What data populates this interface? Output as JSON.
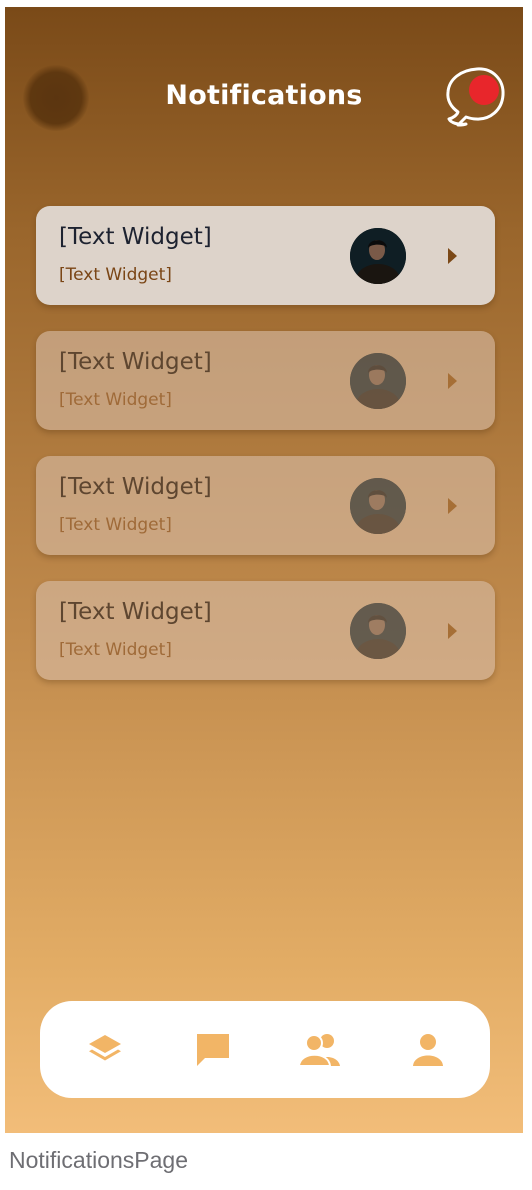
{
  "header": {
    "title": "Notifications"
  },
  "notifications": [
    {
      "title": "[Text Widget]",
      "subtitle": "[Text Widget]"
    },
    {
      "title": "[Text Widget]",
      "subtitle": "[Text Widget]"
    },
    {
      "title": "[Text Widget]",
      "subtitle": "[Text Widget]"
    },
    {
      "title": "[Text Widget]",
      "subtitle": "[Text Widget]"
    }
  ],
  "bottom_nav": {
    "items": [
      {
        "icon": "layers-icon"
      },
      {
        "icon": "chat-icon"
      },
      {
        "icon": "group-icon"
      },
      {
        "icon": "person-icon"
      }
    ]
  },
  "colors": {
    "accent": "#f2b566",
    "alert_dot": "#e8262b",
    "gradient_top": "#7a4a18",
    "gradient_bottom": "#f2bd79"
  },
  "caption": "NotificationsPage"
}
